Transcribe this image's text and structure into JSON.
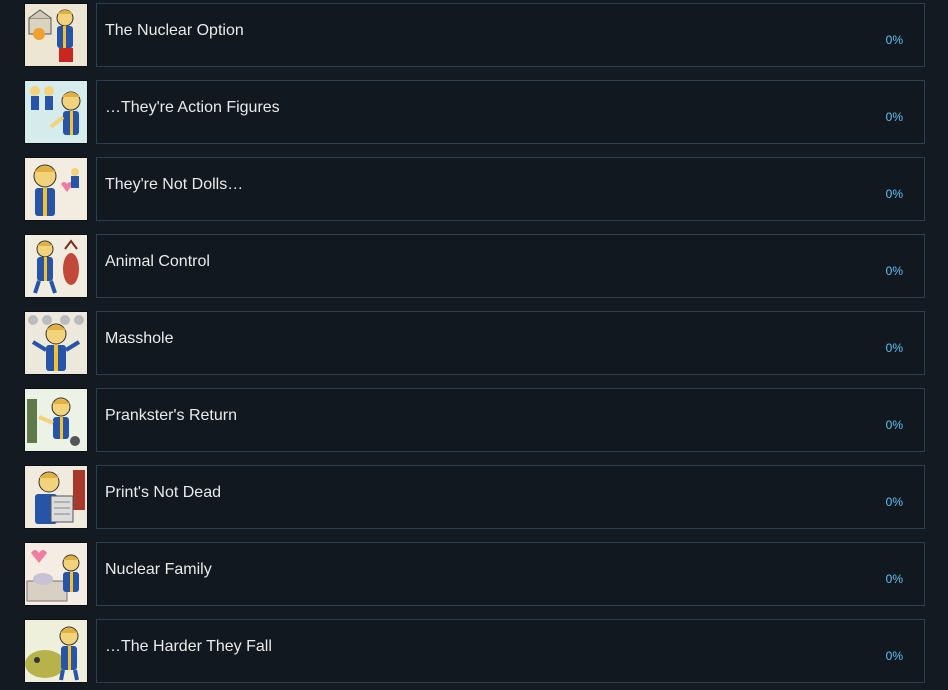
{
  "achievements": [
    {
      "title": "The Nuclear Option",
      "percent": "0%",
      "icon": "vault-boy-nuclear-option-icon"
    },
    {
      "title": "…They're Action Figures",
      "percent": "0%",
      "icon": "vault-boy-action-figures-icon"
    },
    {
      "title": "They're Not Dolls…",
      "percent": "0%",
      "icon": "vault-boy-not-dolls-icon"
    },
    {
      "title": "Animal Control",
      "percent": "0%",
      "icon": "vault-boy-animal-control-icon"
    },
    {
      "title": "Masshole",
      "percent": "0%",
      "icon": "vault-boy-masshole-icon"
    },
    {
      "title": "Prankster's Return",
      "percent": "0%",
      "icon": "vault-boy-prankster-icon"
    },
    {
      "title": "Print's Not Dead",
      "percent": "0%",
      "icon": "vault-boy-newspaper-icon"
    },
    {
      "title": "Nuclear Family",
      "percent": "0%",
      "icon": "vault-boy-nuclear-family-icon"
    },
    {
      "title": "…The Harder They Fall",
      "percent": "0%",
      "icon": "vault-boy-harder-they-fall-icon"
    }
  ],
  "colors": {
    "background": "#131a22",
    "card_border": "#2a3f52",
    "title_text": "#eaeaea",
    "percent_text": "#66c0f4"
  }
}
